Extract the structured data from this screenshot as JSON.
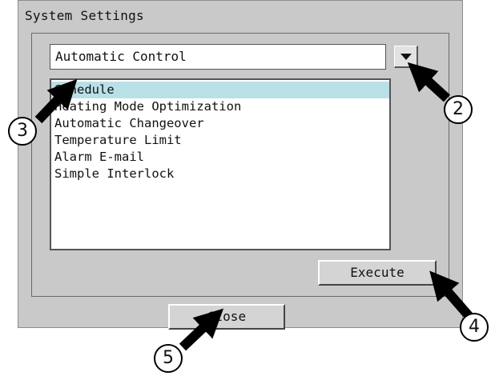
{
  "window": {
    "title": "System Settings"
  },
  "dropdown": {
    "selected": "Automatic Control",
    "button_icon": "triangle-down"
  },
  "list": {
    "items": [
      "Schedule",
      "Heating Mode Optimization",
      "Automatic Changeover",
      "Temperature Limit",
      "Alarm E-mail",
      "Simple Interlock"
    ],
    "selected_index": 0
  },
  "buttons": {
    "execute": "Execute",
    "close": "Close"
  },
  "callouts": [
    "2",
    "3",
    "4",
    "5"
  ]
}
